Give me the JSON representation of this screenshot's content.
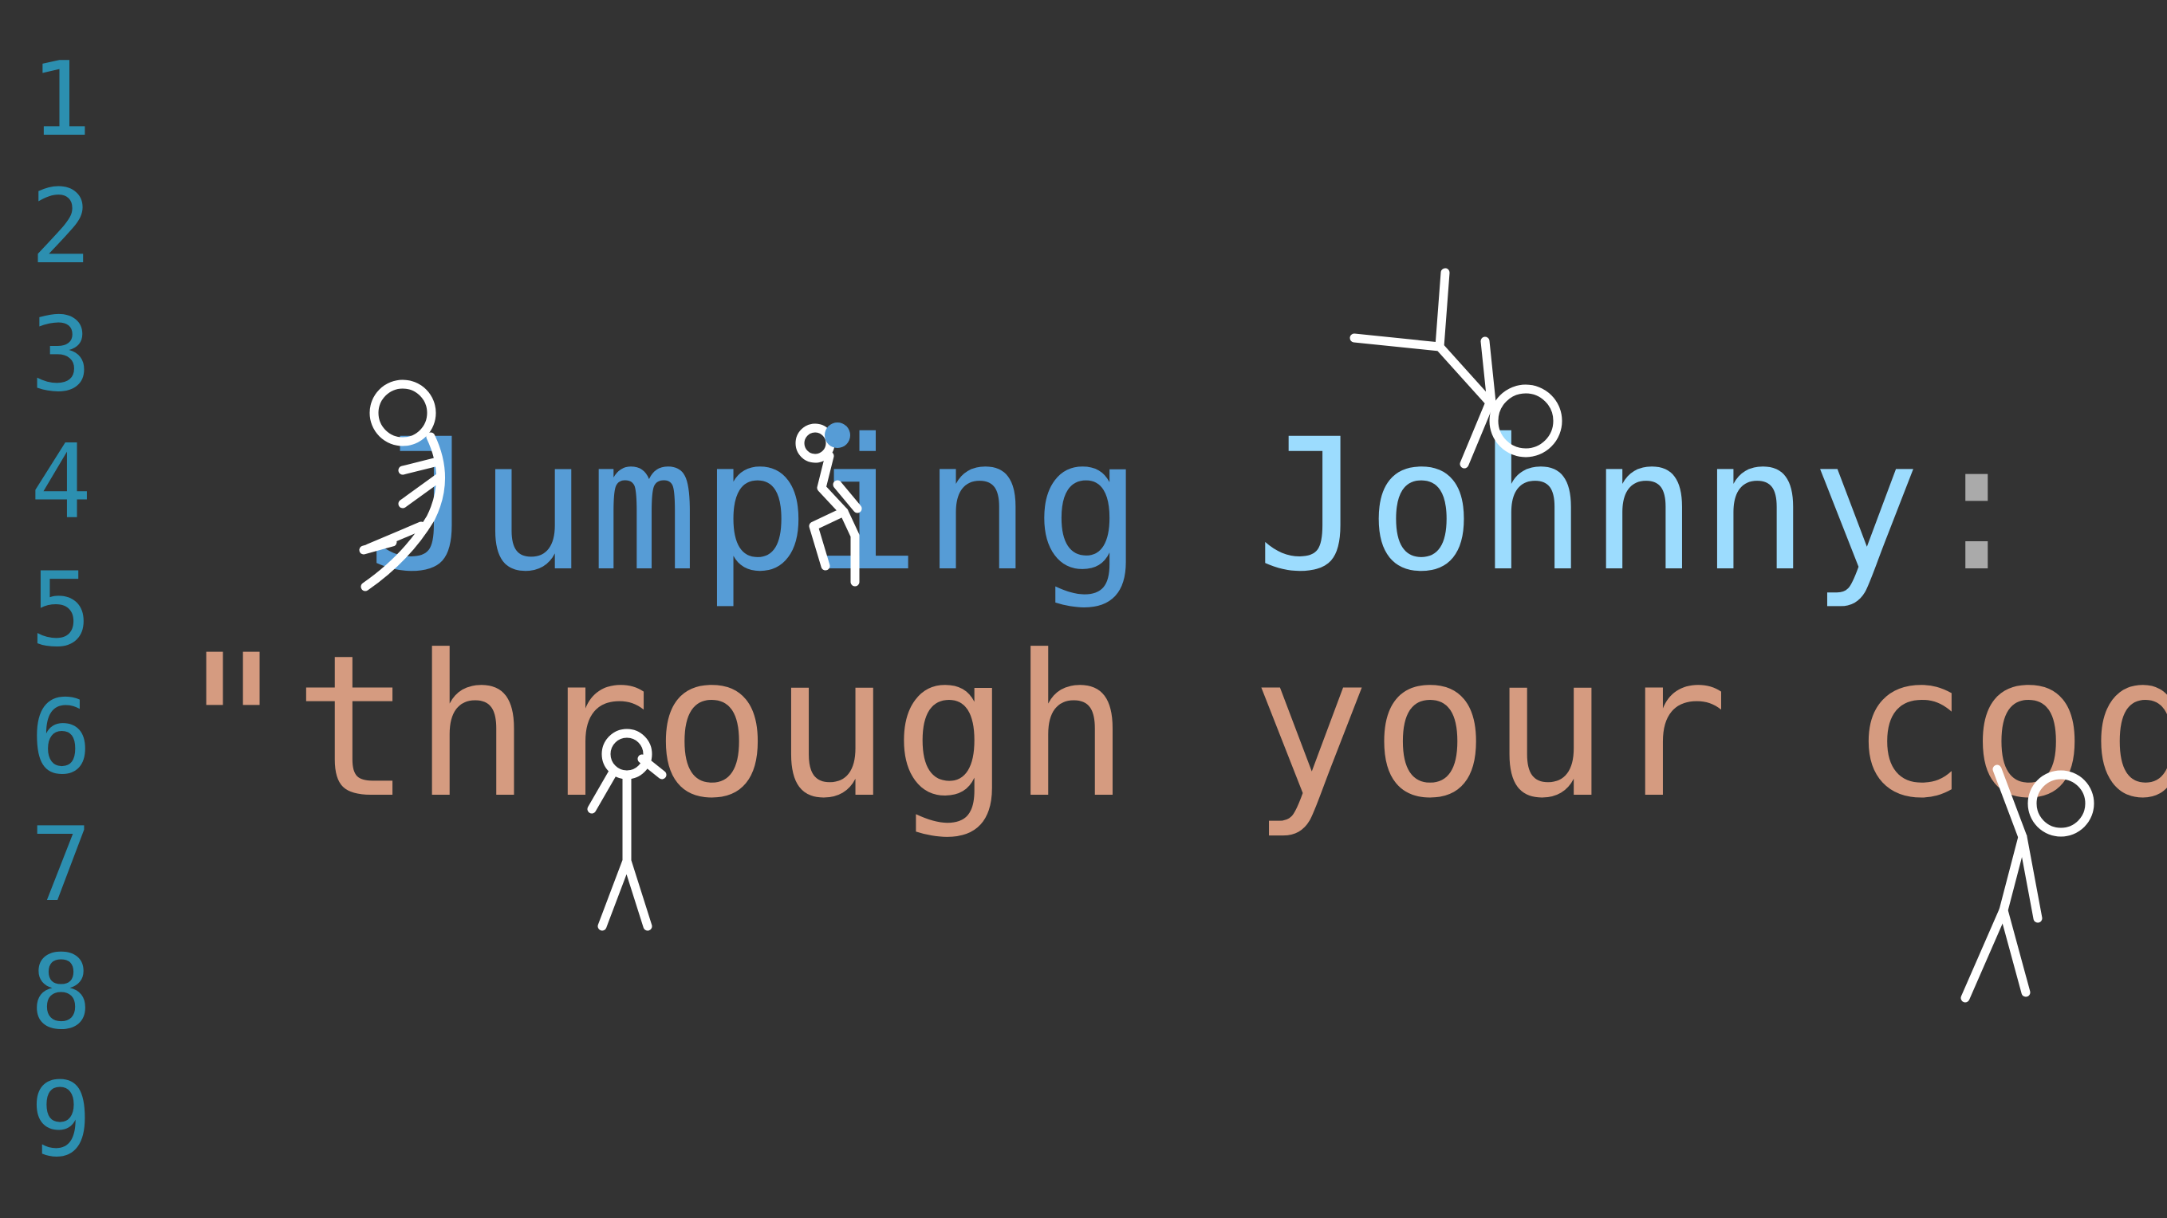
{
  "gutter": {
    "line_numbers": [
      "1",
      "2",
      "3",
      "4",
      "5",
      "6",
      "7",
      "8",
      "9"
    ],
    "color": "#2c8fb0"
  },
  "code": {
    "line4": {
      "word1": "Jumping",
      "space": " ",
      "word2": "Johnny",
      "punct": ":"
    },
    "line6": {
      "text": "\"through your code\""
    },
    "colors": {
      "keyword": "#569cd6",
      "identifier": "#9cdcfe",
      "punctuation": "#aaaaaa",
      "string": "#d59b80",
      "background": "#333333"
    }
  },
  "figures": {
    "count": 5,
    "icon": "stick-figure-icon",
    "accent_dot_color": "#569cd6"
  }
}
